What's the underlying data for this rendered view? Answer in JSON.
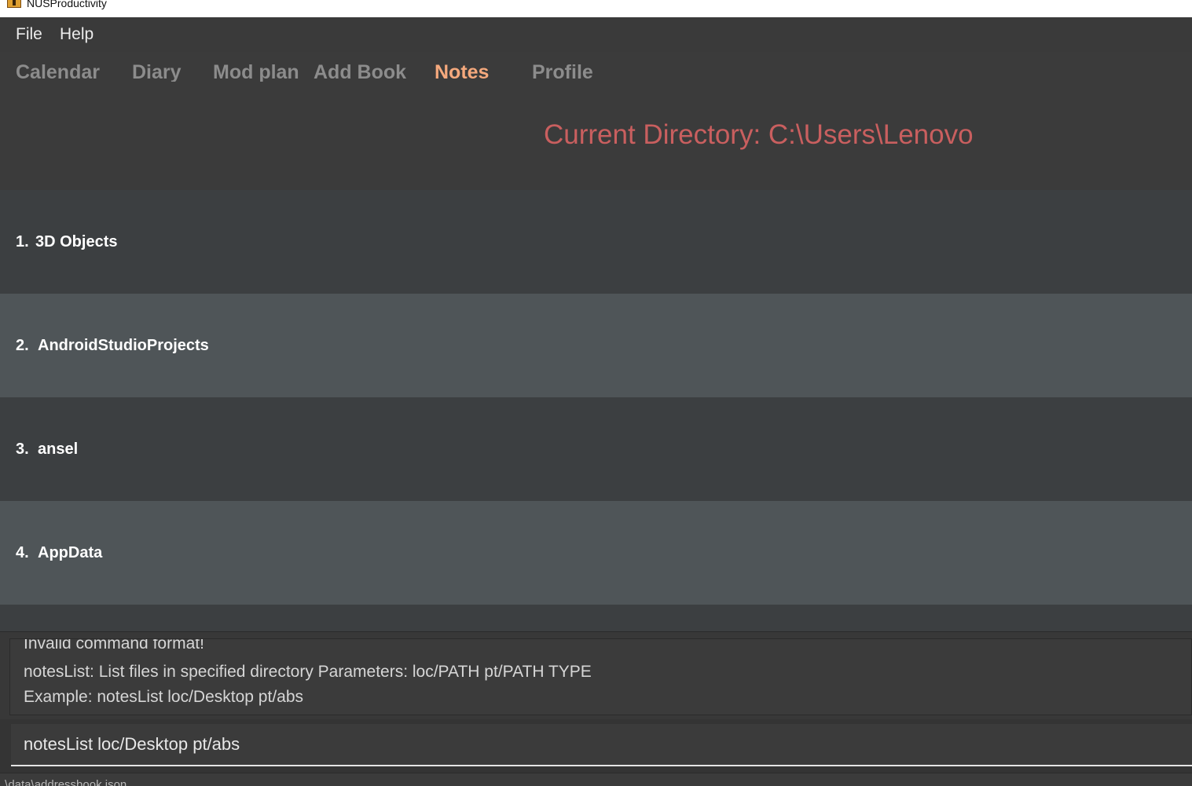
{
  "window": {
    "title": "NUSProductivity",
    "icon": "java-cup-icon"
  },
  "menu": {
    "file": "File",
    "help": "Help"
  },
  "tabs": [
    {
      "label": "Calendar",
      "active": false
    },
    {
      "label": "Diary",
      "active": false
    },
    {
      "label": "Mod plan",
      "active": false
    },
    {
      "label": "Add Book",
      "active": false
    },
    {
      "label": "Notes",
      "active": true
    },
    {
      "label": "Profile",
      "active": false
    }
  ],
  "directory": {
    "title": "Current Directory: C:\\Users\\Lenovo"
  },
  "files": [
    {
      "index": "1.",
      "name": "3D Objects"
    },
    {
      "index": "2.",
      "name": "AndroidStudioProjects"
    },
    {
      "index": "3.",
      "name": "ansel"
    },
    {
      "index": "4.",
      "name": "AppData"
    }
  ],
  "result": {
    "lines": [
      "Invalid command format!",
      "notesList: List files in specified directory Parameters: loc/PATH pt/PATH TYPE",
      "Example: notesList loc/Desktop pt/abs"
    ]
  },
  "command": {
    "value": "notesList loc/Desktop pt/abs"
  },
  "status": {
    "text": ".\\data\\addressbook.json"
  },
  "colors": {
    "background": "#3c3f41",
    "active_tab": "#f5a97d",
    "inactive_tab": "#8c8c8c",
    "directory_title": "#c95f5f",
    "row_alt": "#4f5558"
  }
}
